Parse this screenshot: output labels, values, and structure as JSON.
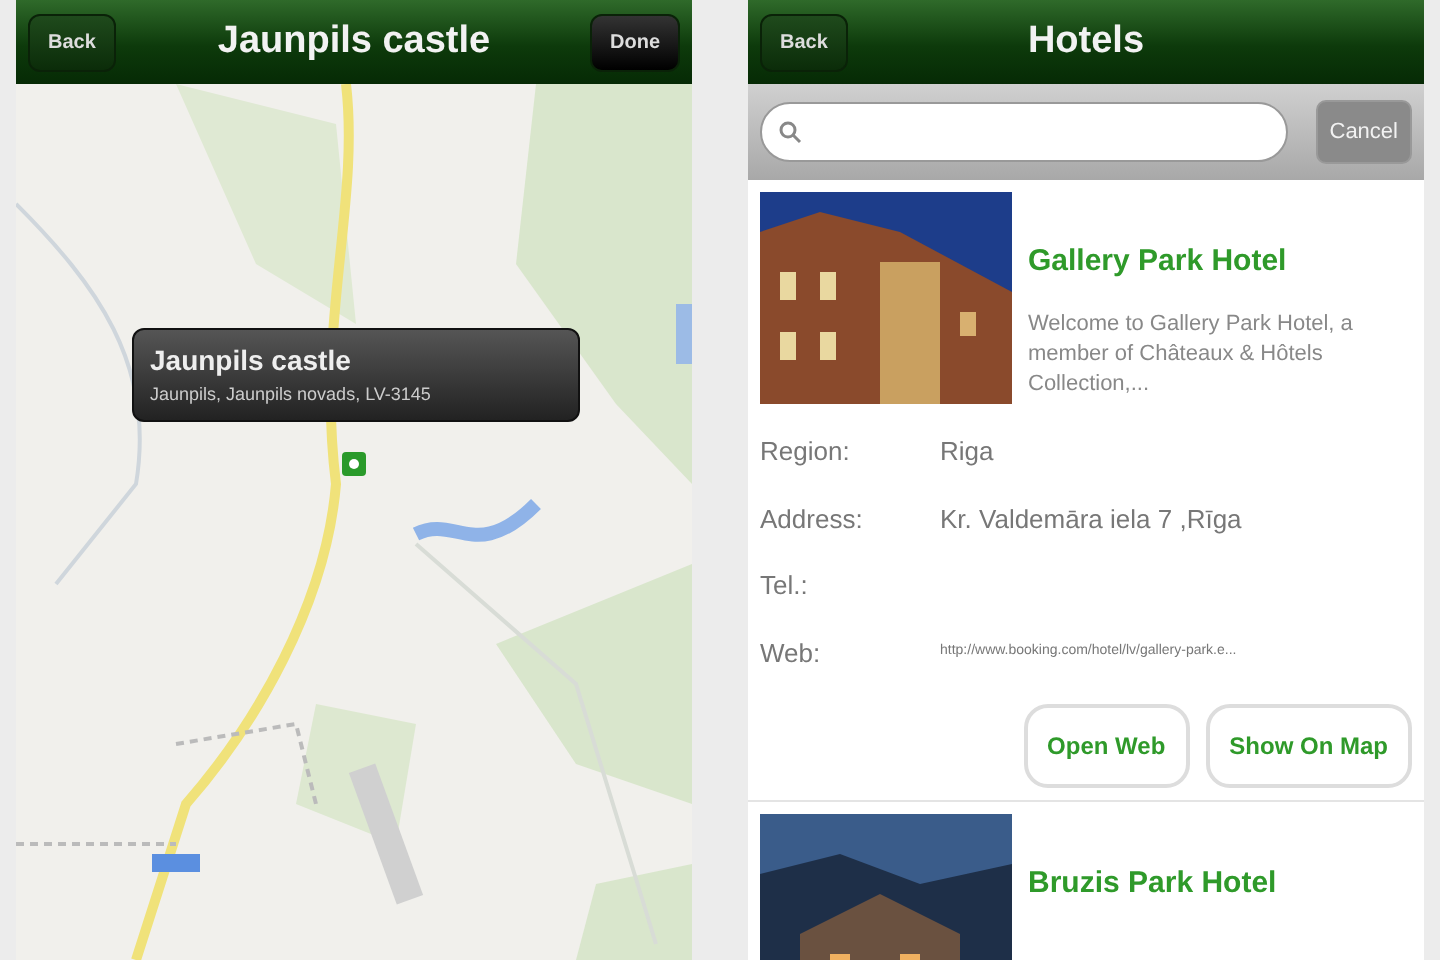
{
  "map_screen": {
    "navbar": {
      "back": "Back",
      "title": "Jaunpils castle",
      "done": "Done"
    },
    "callout": {
      "title": "Jaunpils castle",
      "subtitle": "Jaunpils, Jaunpils novads, LV-3145"
    }
  },
  "hotels_screen": {
    "navbar": {
      "back": "Back",
      "title": "Hotels"
    },
    "search": {
      "cancel": "Cancel",
      "cancel_disabled": true
    },
    "hotels": [
      {
        "name": "Gallery Park Hotel",
        "description": "Welcome to Gallery Park Hotel, a member of Châteaux & Hôtels Collection,...",
        "kind": "picture",
        "fields": [
          {
            "label": "Region:",
            "value": "Riga"
          },
          {
            "label": "Address:",
            "value": "Kr. Valdemāra iela 7 ,Rīga"
          },
          {
            "label": "Tel.:"
          },
          {
            "label": "Web:",
            "value": "http://www.booking.com/hotel/lv/gallery-park.e...",
            "kind": "small"
          }
        ],
        "buttons": [
          "Open Web",
          "Show On Map"
        ]
      },
      {
        "name": "Bruzis Park Hotel",
        "kind": "picture"
      }
    ]
  }
}
